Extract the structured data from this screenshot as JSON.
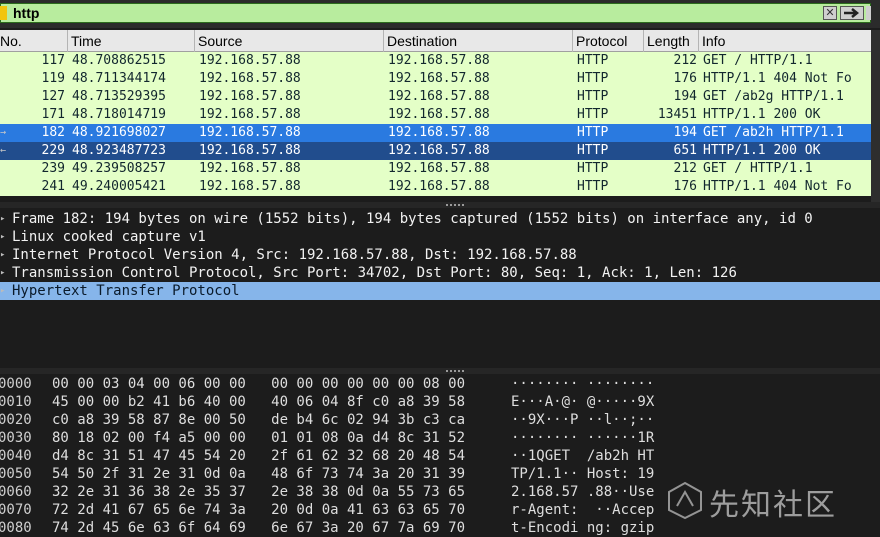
{
  "filter": {
    "value": "http",
    "clear_glyph": "✕",
    "accent": "#b8ec9e"
  },
  "packet_list": {
    "columns": [
      "No.",
      "Time",
      "Source",
      "Destination",
      "Protocol",
      "Length",
      "Info"
    ],
    "rows": [
      {
        "no": "117",
        "time": "48.708862515",
        "source": "192.168.57.88",
        "destination": "192.168.57.88",
        "protocol": "HTTP",
        "length": "212",
        "info": "GET / HTTP/1.1",
        "state": "normal"
      },
      {
        "no": "119",
        "time": "48.711344174",
        "source": "192.168.57.88",
        "destination": "192.168.57.88",
        "protocol": "HTTP",
        "length": "176",
        "info": "HTTP/1.1 404 Not Fo",
        "state": "normal"
      },
      {
        "no": "127",
        "time": "48.713529395",
        "source": "192.168.57.88",
        "destination": "192.168.57.88",
        "protocol": "HTTP",
        "length": "194",
        "info": "GET /ab2g HTTP/1.1",
        "state": "normal"
      },
      {
        "no": "171",
        "time": "48.718014719",
        "source": "192.168.57.88",
        "destination": "192.168.57.88",
        "protocol": "HTTP",
        "length": "13451",
        "info": "HTTP/1.1 200 OK",
        "state": "normal"
      },
      {
        "no": "182",
        "time": "48.921698027",
        "source": "192.168.57.88",
        "destination": "192.168.57.88",
        "protocol": "HTTP",
        "length": "194",
        "info": "GET /ab2h HTTP/1.1",
        "state": "selected",
        "marker": "→"
      },
      {
        "no": "229",
        "time": "48.923487723",
        "source": "192.168.57.88",
        "destination": "192.168.57.88",
        "protocol": "HTTP",
        "length": "651",
        "info": "HTTP/1.1 200 OK",
        "state": "related",
        "marker": "←"
      },
      {
        "no": "239",
        "time": "49.239508257",
        "source": "192.168.57.88",
        "destination": "192.168.57.88",
        "protocol": "HTTP",
        "length": "212",
        "info": "GET / HTTP/1.1",
        "state": "normal"
      },
      {
        "no": "241",
        "time": "49.240005421",
        "source": "192.168.57.88",
        "destination": "192.168.57.88",
        "protocol": "HTTP",
        "length": "176",
        "info": "HTTP/1.1 404 Not Fo",
        "state": "normal"
      }
    ],
    "colors": {
      "http_row": "#e4ffc7",
      "selected": "#2a7ae0",
      "related": "#214d8d"
    }
  },
  "details": {
    "items": [
      {
        "text": "Frame 182: 194 bytes on wire (1552 bits), 194 bytes captured (1552 bits) on interface any, id 0",
        "selected": false
      },
      {
        "text": "Linux cooked capture v1",
        "selected": false
      },
      {
        "text": "Internet Protocol Version 4, Src: 192.168.57.88, Dst: 192.168.57.88",
        "selected": false
      },
      {
        "text": "Transmission Control Protocol, Src Port: 34702, Dst Port: 80, Seq: 1, Ack: 1, Len: 126",
        "selected": false
      },
      {
        "text": "Hypertext Transfer Protocol",
        "selected": true
      }
    ],
    "expander_glyph": "▸"
  },
  "bytes": {
    "rows": [
      {
        "offset": "0000",
        "hex": "00 00 03 04 00 06 00 00   00 00 00 00 00 00 08 00",
        "ascii": "········ ········"
      },
      {
        "offset": "0010",
        "hex": "45 00 00 b2 41 b6 40 00   40 06 04 8f c0 a8 39 58",
        "ascii": "E···A·@· @·····9X"
      },
      {
        "offset": "0020",
        "hex": "c0 a8 39 58 87 8e 00 50   de b4 6c 02 94 3b c3 ca",
        "ascii": "··9X···P ··l··;··"
      },
      {
        "offset": "0030",
        "hex": "80 18 02 00 f4 a5 00 00   01 01 08 0a d4 8c 31 52",
        "ascii": "········ ······1R"
      },
      {
        "offset": "0040",
        "hex": "d4 8c 31 51 47 45 54 20   2f 61 62 32 68 20 48 54",
        "ascii": "··1QGET  /ab2h HT"
      },
      {
        "offset": "0050",
        "hex": "54 50 2f 31 2e 31 0d 0a   48 6f 73 74 3a 20 31 39",
        "ascii": "TP/1.1·· Host: 19"
      },
      {
        "offset": "0060",
        "hex": "32 2e 31 36 38 2e 35 37   2e 38 38 0d 0a 55 73 65",
        "ascii": "2.168.57 .88··Use"
      },
      {
        "offset": "0070",
        "hex": "72 2d 41 67 65 6e 74 3a   20 0d 0a 41 63 63 65 70",
        "ascii": "r-Agent:  ··Accep"
      },
      {
        "offset": "0080",
        "hex": "74 2d 45 6e 63 6f 64 69   6e 67 3a 20 67 7a 69 70",
        "ascii": "t-Encodi ng: gzip"
      }
    ]
  },
  "watermark": {
    "text": "先知社区"
  }
}
